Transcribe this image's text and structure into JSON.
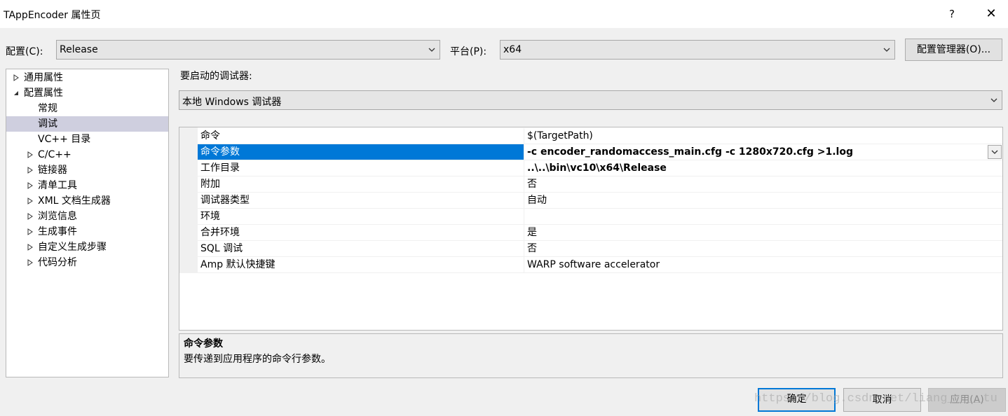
{
  "window": {
    "title": "TAppEncoder 属性页",
    "help_label": "?",
    "close_label": "✕"
  },
  "toolbar": {
    "config_label": "配置(C):",
    "config_value": "Release",
    "platform_label": "平台(P):",
    "platform_value": "x64",
    "config_manager_label": "配置管理器(O)..."
  },
  "debugger": {
    "label": "要启动的调试器:",
    "value": "本地 Windows 调试器"
  },
  "tree": {
    "items": [
      {
        "label": "通用属性",
        "level": 0,
        "expander": "collapsed",
        "selected": false
      },
      {
        "label": "配置属性",
        "level": 0,
        "expander": "expanded",
        "selected": false
      },
      {
        "label": "常规",
        "level": 1,
        "expander": "none",
        "selected": false
      },
      {
        "label": "调试",
        "level": 1,
        "expander": "none",
        "selected": true
      },
      {
        "label": "VC++ 目录",
        "level": 1,
        "expander": "none",
        "selected": false
      },
      {
        "label": "C/C++",
        "level": 1,
        "expander": "collapsed",
        "selected": false
      },
      {
        "label": "链接器",
        "level": 1,
        "expander": "collapsed",
        "selected": false
      },
      {
        "label": "清单工具",
        "level": 1,
        "expander": "collapsed",
        "selected": false
      },
      {
        "label": "XML 文档生成器",
        "level": 1,
        "expander": "collapsed",
        "selected": false
      },
      {
        "label": "浏览信息",
        "level": 1,
        "expander": "collapsed",
        "selected": false
      },
      {
        "label": "生成事件",
        "level": 1,
        "expander": "collapsed",
        "selected": false
      },
      {
        "label": "自定义生成步骤",
        "level": 1,
        "expander": "collapsed",
        "selected": false
      },
      {
        "label": "代码分析",
        "level": 1,
        "expander": "collapsed",
        "selected": false
      }
    ]
  },
  "properties": {
    "rows": [
      {
        "name": "命令",
        "value": "$(TargetPath)",
        "bold": false,
        "selected": false
      },
      {
        "name": "命令参数",
        "value": "-c encoder_randomaccess_main.cfg -c 1280x720.cfg >1.log",
        "bold": true,
        "selected": true
      },
      {
        "name": "工作目录",
        "value": "..\\..\\bin\\vc10\\x64\\Release",
        "bold": true,
        "selected": false
      },
      {
        "name": "附加",
        "value": "否",
        "bold": false,
        "selected": false
      },
      {
        "name": "调试器类型",
        "value": "自动",
        "bold": false,
        "selected": false
      },
      {
        "name": "环境",
        "value": "",
        "bold": false,
        "selected": false
      },
      {
        "name": "合并环境",
        "value": "是",
        "bold": false,
        "selected": false
      },
      {
        "name": "SQL 调试",
        "value": "否",
        "bold": false,
        "selected": false
      },
      {
        "name": "Amp 默认快捷键",
        "value": "WARP software accelerator",
        "bold": false,
        "selected": false
      }
    ]
  },
  "description": {
    "title": "命令参数",
    "text": "要传递到应用程序的命令行参数。"
  },
  "buttons": {
    "ok_label": "确定",
    "cancel_label": "取消",
    "apply_label": "应用(A)"
  },
  "watermark": "https://blog.csdn.net/liang_____tu",
  "colors": {
    "accent": "#0078d7",
    "tree_selection": "#cfcfdf"
  }
}
